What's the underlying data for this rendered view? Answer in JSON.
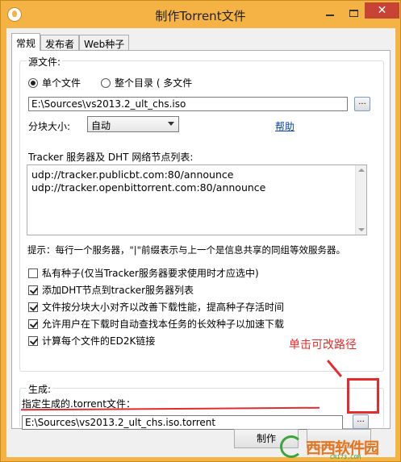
{
  "window": {
    "title": "制作Torrent文件"
  },
  "tabs": [
    {
      "label": "常规",
      "active": true
    },
    {
      "label": "发布者",
      "active": false
    },
    {
      "label": "Web种子",
      "active": false
    }
  ],
  "source": {
    "group_label": "源文件:",
    "radio_single": "单个文件",
    "radio_dir": "整个目录 ( 多文件",
    "path": "E:\\Sources\\vs2013.2_ult_chs.iso",
    "browse": "...",
    "piece_size_label": "分块大小:",
    "piece_size_value": "自动",
    "help_link": "帮助",
    "tracker_label": "Tracker 服务器及 DHT 网络节点列表:",
    "trackers": [
      "udp://tracker.publicbt.com:80/announce",
      "udp://tracker.openbittorrent.com:80/announce"
    ],
    "hint": "提示：每行一个服务器，\"|\"前缀表示与上一个是信息共享的同组等效服务器。",
    "options": [
      {
        "label": "私有种子(仅当Tracker服务器要求使用时才应选中)",
        "checked": false
      },
      {
        "label": "添加DHT节点到tracker服务器列表",
        "checked": true
      },
      {
        "label": "文件按分块大小对齐以改善下载性能，提高种子存活时间",
        "checked": true
      },
      {
        "label": "允许用户在下载时自动查找本任务的长效种子以加速下载",
        "checked": true
      },
      {
        "label": "计算每个文件的ED2K链接",
        "checked": true
      }
    ]
  },
  "output": {
    "group_label": "生成:",
    "field_label": "指定生成的.torrent文件：",
    "path": "E:\\Sources\\vs2013.2_ult_chs.iso.torrent",
    "browse": "..."
  },
  "footer": {
    "make_button": "制作"
  },
  "annotation": {
    "text": "单击可改路径",
    "color": "#e52b2b"
  },
  "watermark": {
    "brand": "西西软件园",
    "site": "CR173.COM"
  },
  "colors": {
    "titlebar": "#f4b344",
    "close": "#c74435",
    "link": "#0645ad"
  }
}
